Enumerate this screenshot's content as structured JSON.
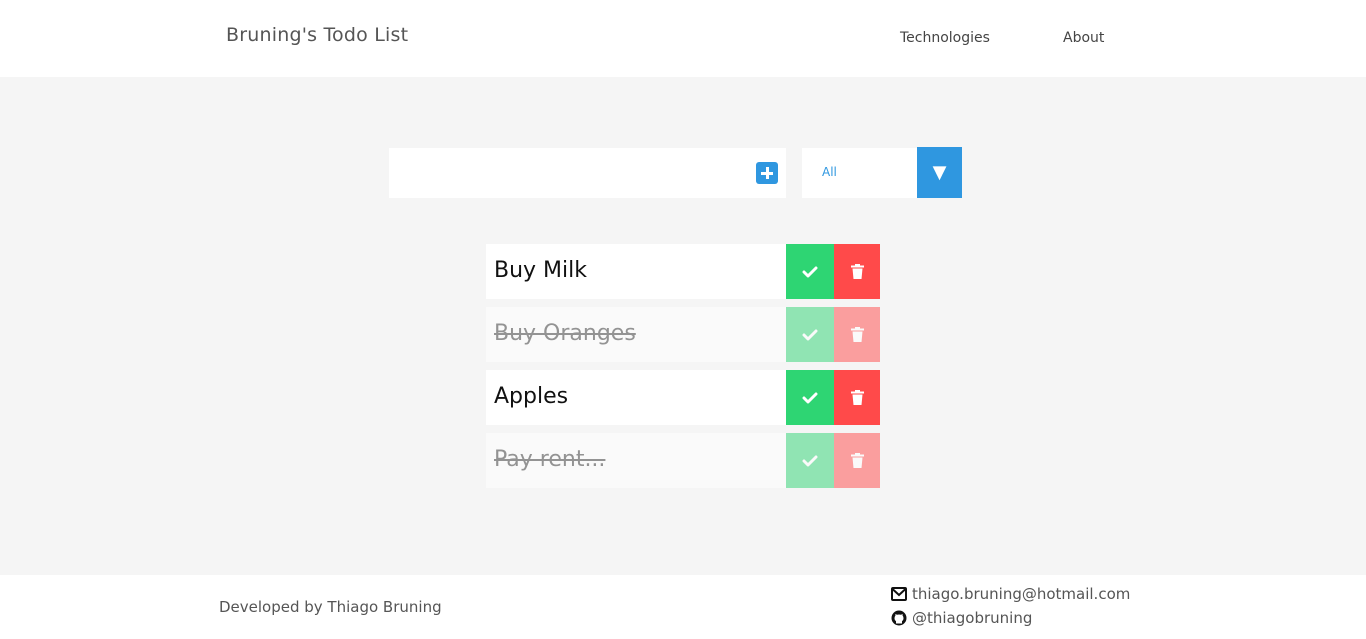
{
  "header": {
    "brand": "Bruning's Todo List",
    "nav": [
      {
        "label": "Technologies"
      },
      {
        "label": "About"
      }
    ]
  },
  "form": {
    "input_value": "",
    "input_placeholder": "",
    "add_icon": "plus-square-icon",
    "filter": {
      "selected": "All",
      "arrow_glyph": "▼"
    }
  },
  "todos": [
    {
      "text": "Buy Milk",
      "completed": false
    },
    {
      "text": "Buy Oranges",
      "completed": true
    },
    {
      "text": "Apples",
      "completed": false
    },
    {
      "text": "Pay rent...",
      "completed": true
    }
  ],
  "footer": {
    "credit": "Developed by Thiago Bruning",
    "email": "thiago.bruning@hotmail.com",
    "github": "@thiagobruning"
  },
  "colors": {
    "accent_blue": "#2f97e0",
    "complete_green": "#2ed573",
    "delete_red": "#ff4a4a",
    "background": "#f5f5f5"
  }
}
